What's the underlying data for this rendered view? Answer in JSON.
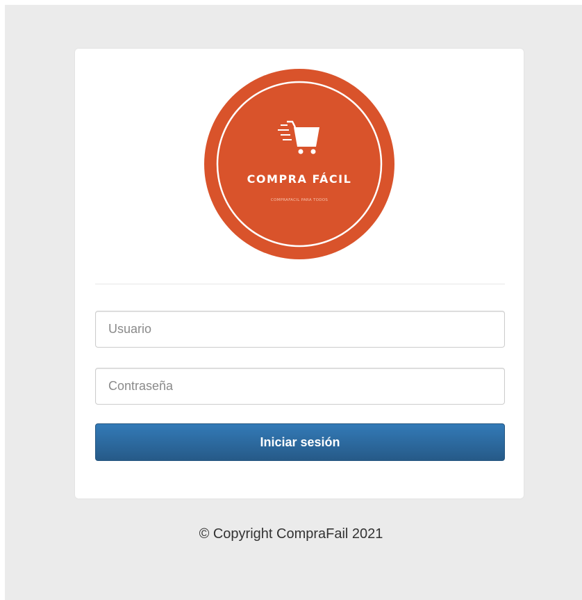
{
  "logo": {
    "brand": "COMPRA FÁCIL",
    "tagline": "COMPRAFACIL PARA TODOS",
    "brand_color": "#d9532b"
  },
  "login": {
    "username_placeholder": "Usuario",
    "password_placeholder": "Contraseña",
    "submit_label": "Iniciar sesión",
    "button_color": "#2e6da4"
  },
  "footer": {
    "copyright": "© Copyright CompraFail 2021"
  }
}
